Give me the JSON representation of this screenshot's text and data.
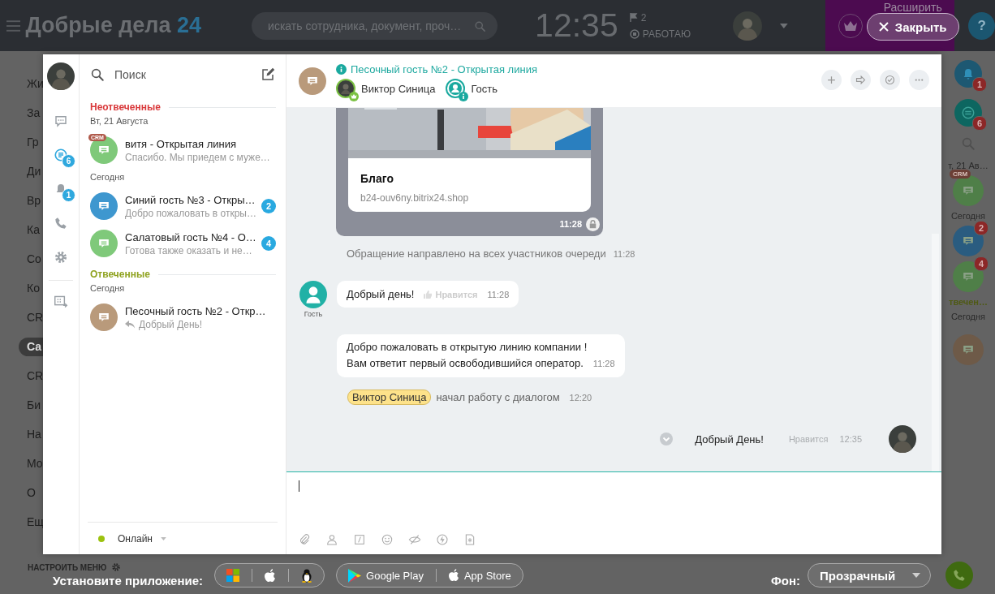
{
  "header": {
    "logo": "Добрые дела",
    "logo_suffix": "24",
    "search": {
      "placeholder": "искать сотрудника, документ, проч…"
    },
    "clock": "12:35",
    "flag_count": "2",
    "status": "РАБОТАЮ",
    "expand_label": "Расширить",
    "close_button": "Закрыть",
    "help": "?"
  },
  "menu": {
    "items": [
      {
        "label": "Жи",
        "selected": false
      },
      {
        "label": "За",
        "selected": false
      },
      {
        "label": "Гр",
        "selected": false
      },
      {
        "label": "Ди",
        "selected": false
      },
      {
        "label": "Вр",
        "selected": false
      },
      {
        "label": "Ка",
        "selected": false
      },
      {
        "label": "Со",
        "selected": false
      },
      {
        "label": "Ко",
        "selected": false
      },
      {
        "label": "CR",
        "selected": false
      },
      {
        "label": "Са",
        "selected": true
      },
      {
        "label": "CR",
        "selected": false
      },
      {
        "label": "Би",
        "selected": false
      },
      {
        "label": "На",
        "selected": false
      },
      {
        "label": "Мо",
        "selected": false
      },
      {
        "label": "О",
        "selected": false
      },
      {
        "label": "Ещ",
        "selected": false
      }
    ]
  },
  "rail": {
    "notifications_badge": "1",
    "openlines_badge": "6",
    "items": [
      {
        "kind": "date",
        "label": "т, 21 Ав…"
      },
      {
        "kind": "chat",
        "color": "#4f7f48",
        "crm": "CRM"
      },
      {
        "kind": "date",
        "label": "Сегодня"
      },
      {
        "kind": "chat",
        "color": "#2a5c80",
        "counter": "2"
      },
      {
        "kind": "chat",
        "color": "#4f7f48",
        "counter": "4"
      },
      {
        "kind": "section",
        "label": "твечен…"
      },
      {
        "kind": "date",
        "label": "Сегодня"
      },
      {
        "kind": "chat",
        "color": "#6e5a48"
      }
    ]
  },
  "footer": {
    "menu_settings": "НАСТРОИТЬ МЕНЮ",
    "install_label": "Установите приложение:",
    "stores": [
      "Google Play",
      "App Store"
    ],
    "background_label": "Фон:",
    "background_value": "Прозрачный"
  },
  "messenger": {
    "nav": [
      {
        "kind": "chats",
        "selected": false
      },
      {
        "kind": "openlines",
        "selected": true,
        "badge": "6"
      },
      {
        "kind": "notifications",
        "selected": false,
        "badge": "1"
      },
      {
        "kind": "phone",
        "selected": false
      },
      {
        "kind": "settings",
        "selected": false
      },
      {
        "kind": "extra",
        "selected": false
      }
    ],
    "recent": {
      "search": {
        "placeholder": "Поиск"
      },
      "sections": [
        {
          "kind": "unanswered",
          "title": "Неотвеченные",
          "groups": [
            {
              "date": "Вт, 21 Августа",
              "items": [
                {
                  "title": "витя - Открытая линия",
                  "preview": "Спасибо. Мы приедем с муже…",
                  "color": "#7fc97a",
                  "crm": "CRM",
                  "own": false
                }
              ]
            },
            {
              "date": "Сегодня",
              "items": [
                {
                  "title": "Синий гость №3 - Откры…",
                  "preview": "Добро пожаловать в откры…",
                  "color": "#3e97cf",
                  "counter": "2",
                  "own": false
                },
                {
                  "title": "Салатовый гость №4 - О…",
                  "preview": "Готова также оказать и не…",
                  "color": "#7fc97a",
                  "counter": "4",
                  "own": false
                }
              ]
            }
          ]
        },
        {
          "kind": "answered",
          "title": "Отвеченные",
          "groups": [
            {
              "date": "Сегодня",
              "items": [
                {
                  "title": "Песочный гость №2 - Откр…",
                  "preview": "Добрый День!",
                  "color": "#b99a7b",
                  "own": true
                }
              ]
            }
          ]
        }
      ],
      "status": "Онлайн"
    },
    "chat": {
      "title": "Песочный гость №2 - Открытая линия",
      "color": "#b99a7b",
      "users": [
        {
          "kind": "operator",
          "name": "Виктор Синица"
        },
        {
          "kind": "guest",
          "name": "Гость"
        }
      ],
      "messages": [
        {
          "kind": "link_card",
          "title": "Благо",
          "url": "b24-ouv6ny.bitrix24.shop",
          "time": "11:28"
        },
        {
          "kind": "system",
          "text": "Обращение направлено на всех участников очереди",
          "time": "11:28"
        },
        {
          "kind": "incoming",
          "author": "Гость",
          "text": "Добрый день!",
          "like": "Нравится",
          "time": "11:28"
        },
        {
          "kind": "incoming_more",
          "lines": [
            "Добро пожаловать в открытую линию компании !",
            "Вам ответит первый освободившийся оператор."
          ],
          "time": "11:28"
        },
        {
          "kind": "user_event",
          "user": "Виктор Синица",
          "text": "начал работу с диалогом",
          "time": "12:20"
        },
        {
          "kind": "outgoing",
          "text": "Добрый День!",
          "like": "Нравится",
          "time": "12:35"
        }
      ]
    }
  }
}
